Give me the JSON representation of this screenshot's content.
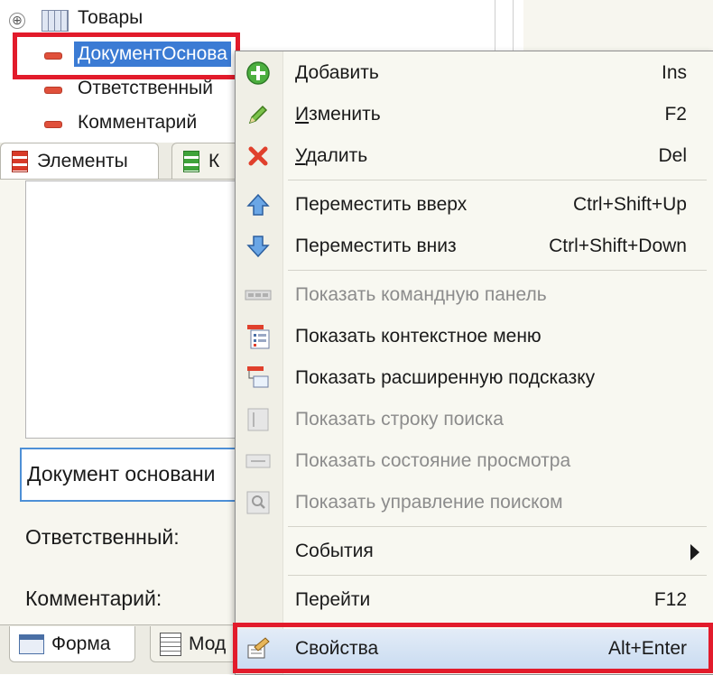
{
  "tree": {
    "items": [
      {
        "label": "Товары",
        "kind": "table"
      },
      {
        "label": "ДокументОснова",
        "kind": "field",
        "selected": true
      },
      {
        "label": "Ответственный",
        "kind": "field"
      },
      {
        "label": "Комментарий",
        "kind": "field"
      }
    ],
    "expander_glyph": "⊕"
  },
  "tabs_top": [
    {
      "label": "Элементы",
      "icon": "elements-icon"
    },
    {
      "label": "К",
      "icon": "commands-icon"
    }
  ],
  "form": {
    "doc_field_value": "Документ основани",
    "responsible_label": "Ответственный:",
    "comment_label": "Комментарий:"
  },
  "tabs_bottom": [
    {
      "label": "Форма",
      "icon": "form-icon"
    },
    {
      "label": "Мод",
      "icon": "module-icon"
    }
  ],
  "menu": {
    "items": [
      {
        "label": "Добавить",
        "accel": "Д",
        "shortcut": "Ins",
        "icon": "add-icon",
        "enabled": true
      },
      {
        "label": "Изменить",
        "accel": "И",
        "shortcut": "F2",
        "icon": "edit-pencil-icon",
        "enabled": true
      },
      {
        "label": "Удалить",
        "accel": "У",
        "shortcut": "Del",
        "icon": "delete-x-icon",
        "enabled": true
      },
      {
        "label": "Переместить вверх",
        "shortcut": "Ctrl+Shift+Up",
        "icon": "move-up-icon",
        "enabled": true
      },
      {
        "label": "Переместить вниз",
        "shortcut": "Ctrl+Shift+Down",
        "icon": "move-down-icon",
        "enabled": true
      },
      {
        "label": "Показать командную панель",
        "shortcut": "",
        "icon": "command-panel-icon",
        "enabled": false
      },
      {
        "label": "Показать контекстное меню",
        "shortcut": "",
        "icon": "context-menu-icon",
        "enabled": true
      },
      {
        "label": "Показать расширенную подсказку",
        "shortcut": "",
        "icon": "extended-tooltip-icon",
        "enabled": true
      },
      {
        "label": "Показать строку поиска",
        "shortcut": "",
        "icon": "search-string-icon",
        "enabled": false
      },
      {
        "label": "Показать состояние просмотра",
        "shortcut": "",
        "icon": "view-state-icon",
        "enabled": false
      },
      {
        "label": "Показать управление поиском",
        "shortcut": "",
        "icon": "search-control-icon",
        "enabled": false
      },
      {
        "label": "События",
        "shortcut": "",
        "icon": "",
        "enabled": true,
        "submenu": true
      },
      {
        "label": "Перейти",
        "shortcut": "F12",
        "icon": "",
        "enabled": true
      },
      {
        "label": "Свойства",
        "shortcut": "Alt+Enter",
        "icon": "properties-icon",
        "enabled": true,
        "highlighted": true
      }
    ]
  },
  "colors": {
    "highlight_box": "#e21b2b",
    "selection": "#3b7bd4",
    "disabled_text": "#8c8c8c"
  }
}
